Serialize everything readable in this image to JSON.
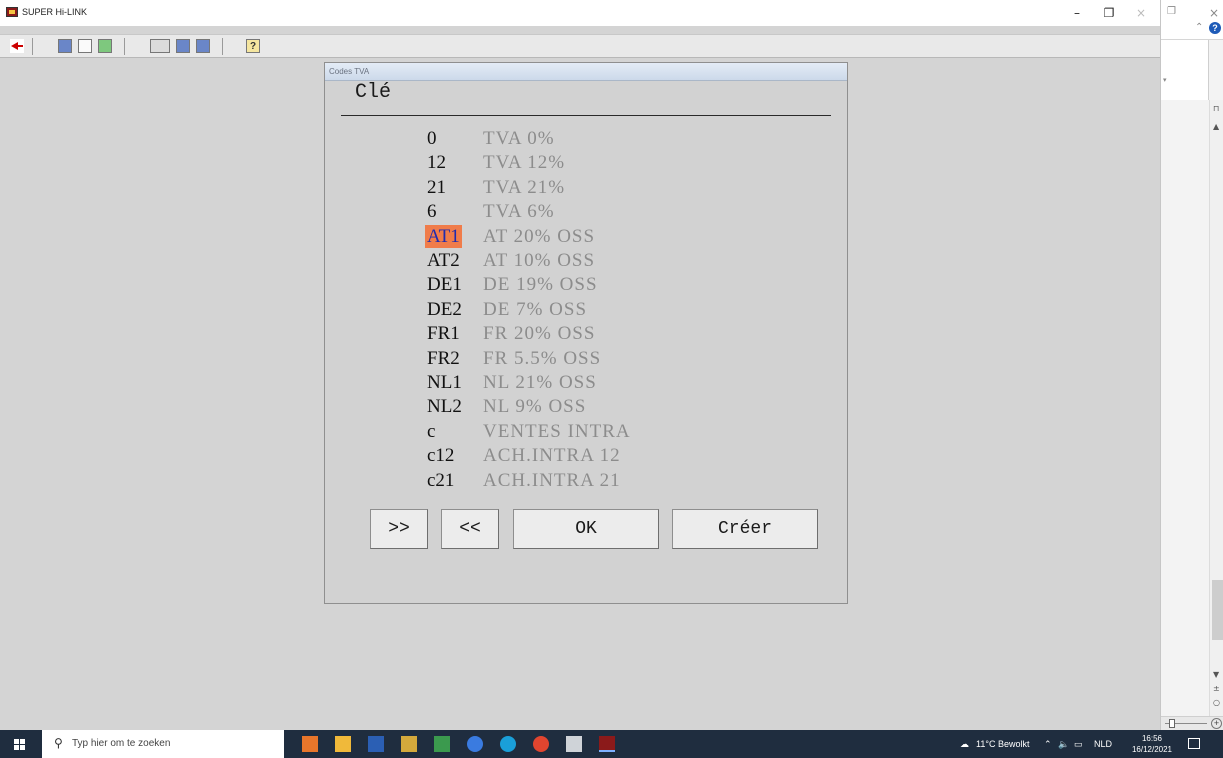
{
  "window": {
    "title": "SUPER Hi-LINK",
    "minimize": "–",
    "restore": "❐",
    "close": "×"
  },
  "dialog": {
    "title": "Codes TVA",
    "field_label": "Clé",
    "selected_index": 4,
    "rows": [
      {
        "code": "0",
        "desc": "TVA 0%"
      },
      {
        "code": "12",
        "desc": "TVA 12%"
      },
      {
        "code": "21",
        "desc": "TVA 21%"
      },
      {
        "code": "6",
        "desc": "TVA 6%"
      },
      {
        "code": "AT1",
        "desc": "AT 20% OSS"
      },
      {
        "code": "AT2",
        "desc": "AT 10% OSS"
      },
      {
        "code": "DE1",
        "desc": "DE 19% OSS"
      },
      {
        "code": "DE2",
        "desc": "DE 7% OSS"
      },
      {
        "code": "FR1",
        "desc": "FR 20% OSS"
      },
      {
        "code": "FR2",
        "desc": "FR 5.5% OSS"
      },
      {
        "code": "NL1",
        "desc": "NL 21% OSS"
      },
      {
        "code": "NL2",
        "desc": "NL 9%  OSS"
      },
      {
        "code": "c",
        "desc": "VENTES INTRA"
      },
      {
        "code": "c12",
        "desc": "ACH.INTRA 12"
      },
      {
        "code": "c21",
        "desc": "ACH.INTRA 21"
      }
    ],
    "buttons": {
      "next": ">>",
      "prev": "<<",
      "ok": "OK",
      "create": "Créer"
    }
  },
  "taskbar": {
    "search_placeholder": "Typ hier om te zoeken",
    "weather": "11°C  Bewolkt",
    "language": "NLD",
    "time": "16:56",
    "date": "16/12/2021"
  },
  "colors": {
    "selection_bg": "#f07c4a",
    "selection_text": "#1f2bb0",
    "taskbar_bg": "#1f2d3f"
  }
}
